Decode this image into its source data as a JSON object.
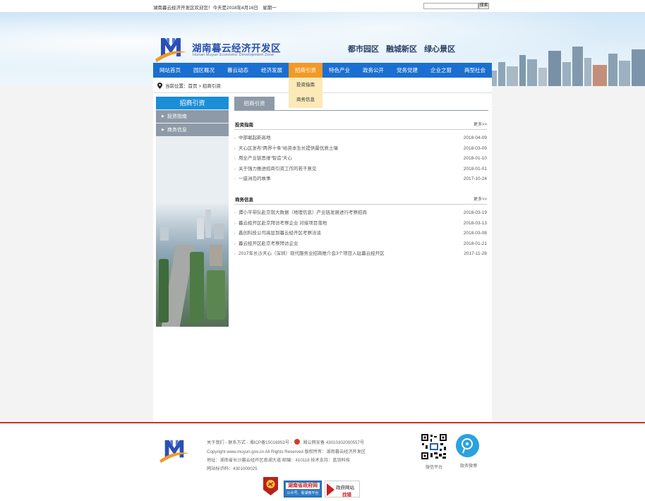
{
  "topbar": {
    "welcome": "湖南暮云经济开发区欢迎您！今天是2018年4月16日　星期一",
    "search_placeholder": "",
    "search_button": "搜索"
  },
  "header": {
    "title": "湖南暮云经济开发区",
    "subtitle": "Hunan Muyun Economic Development Zone",
    "slogans": [
      "都市园区",
      "融城新区",
      "绿心景区"
    ]
  },
  "nav": {
    "items": [
      {
        "label": "网站首页"
      },
      {
        "label": "园区概况"
      },
      {
        "label": "暮云动态"
      },
      {
        "label": "经济发展"
      },
      {
        "label": "招商引资"
      },
      {
        "label": "特色产业"
      },
      {
        "label": "政务公开"
      },
      {
        "label": "党务党建"
      },
      {
        "label": "企业之窗"
      },
      {
        "label": "两型社会"
      }
    ],
    "active_index": 4,
    "dropdown": [
      "投资指南",
      "商务信息"
    ]
  },
  "breadcrumb": {
    "label": "当前位置：",
    "home": "首页",
    "sep": ">",
    "current": "招商引资"
  },
  "sidebar": {
    "title": "招商引资",
    "items": [
      {
        "label": "投资指南"
      },
      {
        "label": "商务信息"
      }
    ]
  },
  "content": {
    "tab": "招商引资",
    "sections": [
      {
        "title": "投资指南",
        "more": "更多>>",
        "items": [
          {
            "title": "中部崛起新高地",
            "date": "2018-04-09"
          },
          {
            "title": "天心区发布“两界十条”给资本生长提供最优质土壤",
            "date": "2018-03-09"
          },
          {
            "title": "用全产业链思维“智造”天心",
            "date": "2018-01-10"
          },
          {
            "title": "关于强力推进招商引资工作的若干意见",
            "date": "2018-01-01"
          },
          {
            "title": "一座洲岛的故事",
            "date": "2017-10-24"
          }
        ]
      },
      {
        "title": "商务信息",
        "more": "更多>>",
        "items": [
          {
            "title": "谭小平带队赴京就大数据（地理信息）产业链发展进行考察招商",
            "date": "2018-03-19"
          },
          {
            "title": "暮云经开区赴京拜访考察企业 对接项目落地",
            "date": "2018-03-13"
          },
          {
            "title": "鑫创科技公司高层到暮云经开区考察洽谈",
            "date": "2018-03-08"
          },
          {
            "title": "暮云经开区赴京考察拜访企业",
            "date": "2018-01-21"
          },
          {
            "title": "2017年长沙天心（深圳）现代服务业招商推介会3个项目入驻暮云经开区",
            "date": "2017-11-28"
          }
        ]
      }
    ]
  },
  "footer": {
    "line1": "关于我们 - 联系方式 - 湘ICP备15016953号 -",
    "police": "湘公网安备 43010302000557号",
    "line2": "Copyright www.muyun.gov.cn All Rights Reserved  版权所有：湖南暮云经济开发区",
    "line3": "地址：湖南省长沙暮云经开区南湖大道  邮编：410118  技术支持：蓝羽科技",
    "line4": "网站标识码：4301000025",
    "wechat_caption": "微信平台",
    "weibo_caption": "政务微博",
    "badge_gov_name": "湖南省政府网",
    "badge_gov_sub": "公众号、看湖南平台",
    "badge_error_title": "政府网站",
    "badge_error_sub": "找错"
  }
}
